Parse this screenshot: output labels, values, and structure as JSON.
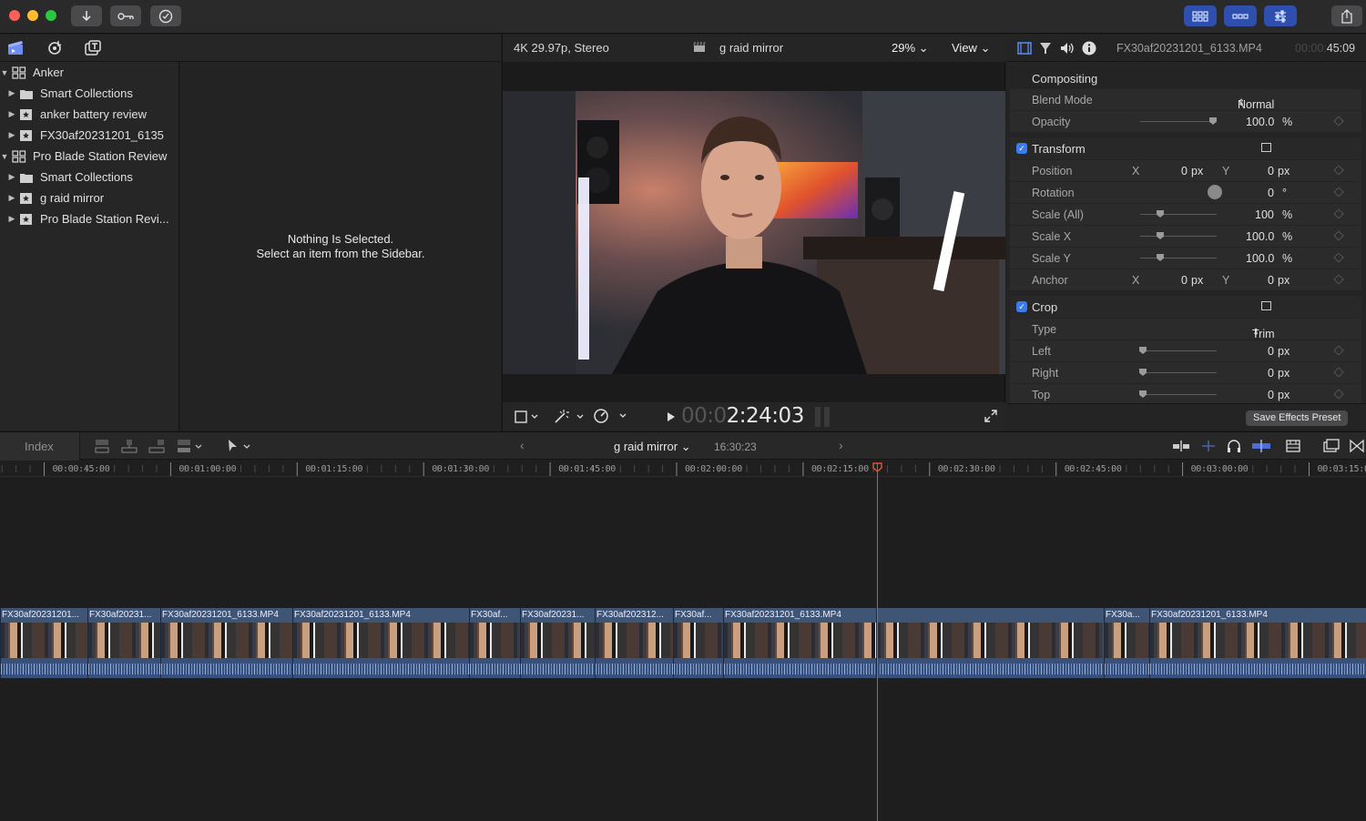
{
  "colors": {
    "accent": "#3b7bf0",
    "playhead": "#d9542e",
    "clip": "#3f5576"
  },
  "toolbar": {
    "import_icon": "download-arrow-icon",
    "keywords_icon": "key-icon",
    "analysis_icon": "checkmark-circle-icon",
    "share_icon": "share-icon"
  },
  "libraries": {
    "items": [
      {
        "label": "Anker",
        "level": 0,
        "expanded": true,
        "kind": "library"
      },
      {
        "label": "Smart Collections",
        "level": 1,
        "expanded": false,
        "kind": "folder"
      },
      {
        "label": "anker battery review",
        "level": 1,
        "expanded": false,
        "kind": "event"
      },
      {
        "label": "FX30af20231201_6135",
        "level": 1,
        "expanded": false,
        "kind": "event"
      },
      {
        "label": "Pro Blade Station Review",
        "level": 0,
        "expanded": true,
        "kind": "library"
      },
      {
        "label": "Smart Collections",
        "level": 1,
        "expanded": false,
        "kind": "folder"
      },
      {
        "label": "g raid mirror",
        "level": 1,
        "expanded": false,
        "kind": "event"
      },
      {
        "label": "Pro Blade Station Revi...",
        "level": 1,
        "expanded": false,
        "kind": "event"
      }
    ]
  },
  "browser": {
    "empty_title": "Nothing Is Selected.",
    "empty_subtitle": "Select an item from the Sidebar."
  },
  "viewer": {
    "format": "4K 29.97p, Stereo",
    "project": "g raid mirror",
    "zoom": "29%",
    "view_label": "View",
    "timecode_dim": "00:0",
    "timecode": "2:24:03"
  },
  "inspector": {
    "clip_name": "FX30af20231201_6133.MP4",
    "duration_dim": "00:00:",
    "duration": "45:09",
    "compositing": {
      "title": "Compositing",
      "blend_label": "Blend Mode",
      "blend_value": "Normal",
      "opacity_label": "Opacity",
      "opacity_value": "100.0",
      "opacity_unit": "%"
    },
    "transform": {
      "title": "Transform",
      "position_label": "Position",
      "x": "X",
      "x_val": "0",
      "y": "Y",
      "y_val": "0",
      "px": "px",
      "rotation_label": "Rotation",
      "rotation_val": "0",
      "rotation_unit": "°",
      "scale_all_label": "Scale (All)",
      "scale_all_val": "100",
      "scale_x_label": "Scale X",
      "scale_x_val": "100.0",
      "scale_y_label": "Scale Y",
      "scale_y_val": "100.0",
      "pct": "%",
      "anchor_label": "Anchor"
    },
    "crop": {
      "title": "Crop",
      "type_label": "Type",
      "type_value": "Trim",
      "left_label": "Left",
      "right_label": "Right",
      "top_label": "Top",
      "val": "0",
      "px": "px"
    },
    "save_preset": "Save Effects Preset"
  },
  "timeline": {
    "index_label": "Index",
    "project": "g raid mirror",
    "duration": "16:30:23",
    "ruler": [
      "00:00:45:00",
      "00:01:00:00",
      "00:01:15:00",
      "00:01:30:00",
      "00:01:45:00",
      "00:02:00:00",
      "00:02:15:00",
      "00:02:30:00",
      "00:02:45:00",
      "00:03:00:00",
      "00:03:15:0"
    ],
    "clips": [
      "FX30af20231201...",
      "FX30af20231...",
      "FX30af20231201_6133.MP4",
      "FX30af20231201_6133.MP4",
      "FX30af...",
      "FX30af20231...",
      "FX30af202312...",
      "FX30af...",
      "FX30af20231201_6133.MP4",
      "",
      "FX30a...",
      "FX30af20231201_6133.MP4"
    ]
  }
}
